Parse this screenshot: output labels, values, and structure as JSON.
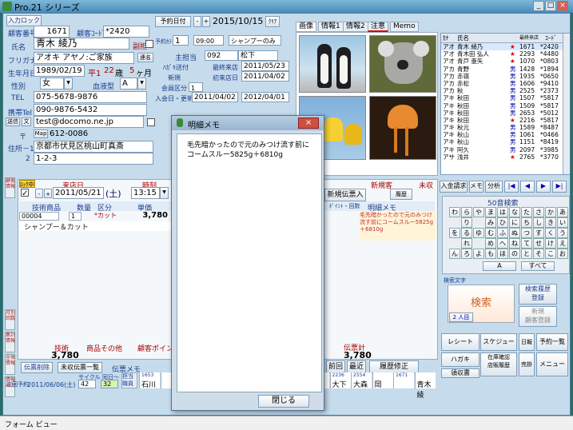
{
  "window": {
    "title": "Pro.21 シリーズ",
    "status": "フォーム ビュー"
  },
  "header": {
    "entry_lock_btn": "入力ロック",
    "customer_no_label": "顧客番号",
    "customer_no": "1671",
    "customer_code_label": "顧客ｺｰﾄﾞ",
    "customer_code": "*2420",
    "name_label": "氏名",
    "name": "青木 綾乃",
    "furigana_label": "フリガナ",
    "furigana": "アオキ アヤノ:ご家族",
    "birthday_label": "生年月日",
    "birthday": "1989/02/19",
    "era": "平1",
    "age": "22",
    "age_unit": "歳",
    "months": "5",
    "months_unit": "ヶ月",
    "sex_label": "性別",
    "sex": "女",
    "blood_label": "血液型",
    "blood": "A",
    "tel_label": "TEL",
    "tel": "075-5678-9876",
    "mobile_label": "携帯Tel",
    "mobile": "090-9876-5432",
    "email_btn": "送信",
    "email_btn2": "文",
    "email": "test@docomo.ne.jp",
    "zip_label": "〒",
    "zip": "612-0086",
    "map_btn": "Map",
    "addr1_label": "住所－1",
    "addr1": "京都市伏見区桃山町真斎",
    "addr2_label": "2",
    "addr2": "1-2-3",
    "sub_check_label": "副担",
    "family_btn": "連名",
    "reservation_btn": "予約日付",
    "reservation_date": "2015/10/15",
    "clear_btn": "ｸﾘｱ",
    "appt_time_label": "予約ｶﾃ",
    "appt_time": "09:00",
    "appt_menu": "シャンプーのみ",
    "main_staff_label": "主担当",
    "main_staff_code": "092",
    "main_staff": "松下",
    "hagaki_label": "ﾊｶﾞｷ送付",
    "last_visit_label": "最終来店",
    "last_visit": "2011/05/23",
    "new_label": "新規",
    "first_visit_label": "初来店日",
    "first_visit": "2011/04/02",
    "member_label": "会員区分",
    "member": "1",
    "join_label": "入会日・更新",
    "join_date": "2011/04/02",
    "renew_date": "2012/04/01",
    "col1_label": "ヨ",
    "col2_label": "ヘ",
    "col3_label": "ロ",
    "col4_label": "ヨ",
    "col5_label": "ロ"
  },
  "tabs": [
    "画像",
    "情報1",
    "情報2",
    "注意",
    "Memo"
  ],
  "photos": [
    "penguins-photo",
    "koala-photo",
    "tulips-photo",
    "jellyfish-photo"
  ],
  "list": {
    "headers": [
      "ｶﾅ",
      "氏名",
      "最終来店",
      "ｺｰﾄﾞ"
    ],
    "rows": [
      {
        "kana": "アオ",
        "name": "青木 綾乃",
        "mark": "★",
        "no": "1671",
        "code": "*2420"
      },
      {
        "kana": "アオ",
        "name": "青木田 弘人",
        "mark": "★",
        "no": "2293",
        "code": "*4480"
      },
      {
        "kana": "アオ",
        "name": "青戸 亜矢",
        "mark": "★",
        "no": "1070",
        "code": "*0803"
      },
      {
        "kana": "アカ",
        "name": "青野",
        "mark": "男",
        "no": "1428",
        "code": "*1894"
      },
      {
        "kana": "アカ",
        "name": "赤嶺",
        "mark": "男",
        "no": "1935",
        "code": "*0650"
      },
      {
        "kana": "アカ",
        "name": "赤松",
        "mark": "男",
        "no": "1606",
        "code": "*9410"
      },
      {
        "kana": "アカ",
        "name": "秋",
        "mark": "男",
        "no": "2525",
        "code": "*2373"
      },
      {
        "kana": "アキ",
        "name": "秋田",
        "mark": "男",
        "no": "1507",
        "code": "*5817"
      },
      {
        "kana": "アキ",
        "name": "秋田",
        "mark": "男",
        "no": "1509",
        "code": "*5817"
      },
      {
        "kana": "アキ",
        "name": "秋田",
        "mark": "男",
        "no": "2653",
        "code": "*5012"
      },
      {
        "kana": "アキ",
        "name": "秋田",
        "mark": "★",
        "no": "2216",
        "code": "*5817"
      },
      {
        "kana": "アキ",
        "name": "秋元",
        "mark": "男",
        "no": "1589",
        "code": "*8487"
      },
      {
        "kana": "アキ",
        "name": "秋山",
        "mark": "男",
        "no": "1061",
        "code": "*0466"
      },
      {
        "kana": "アキ",
        "name": "秋山",
        "mark": "男",
        "no": "1151",
        "code": "*8419"
      },
      {
        "kana": "アキ",
        "name": "阿久",
        "mark": "男",
        "no": "2097",
        "code": "*3985"
      },
      {
        "kana": "アサ",
        "name": "浅井",
        "mark": "★",
        "no": "2765",
        "code": "*3770"
      }
    ]
  },
  "nav": {
    "buttons": [
      "入金請求",
      "メモ",
      "分析"
    ],
    "first": "|◀",
    "prev": "◀",
    "next": "▶",
    "last": "▶|"
  },
  "kana_search": {
    "title": "50音検索",
    "grid": [
      "わ",
      "ら",
      "や",
      "ま",
      "は",
      "な",
      "た",
      "さ",
      "か",
      "あ",
      "",
      "り",
      "",
      "み",
      "ひ",
      "に",
      "ち",
      "し",
      "き",
      "い",
      "を",
      "る",
      "ゆ",
      "む",
      "ふ",
      "ぬ",
      "つ",
      "す",
      "く",
      "う",
      "",
      "れ",
      "",
      "め",
      "へ",
      "ね",
      "て",
      "せ",
      "け",
      "え",
      "ん",
      "ろ",
      "よ",
      "も",
      "ほ",
      "の",
      "と",
      "そ",
      "こ",
      "お"
    ],
    "a_btn": "A",
    "all_btn": "すべて",
    "search_char_label": "検索文字",
    "search_btn": "検索",
    "history_btn": "検索履歴\n登録",
    "new_reg_btn": "新規\n顧客登録",
    "count": "2 人目"
  },
  "right_menu": {
    "receipt": "レシート",
    "schedule": "スケジュール",
    "calendar": "日報",
    "appt_list": "予約一覧",
    "hagaki": "ハガキ",
    "visit_check": "在庫確認\n店販履歴",
    "receivable": "売掛",
    "menu": "メニュー",
    "receipt2": "領収書",
    "survey": "集計"
  },
  "slip": {
    "lock_label": "ﾛｯｸ中",
    "visit_label": "来店日",
    "visit_date": "2011/05/21",
    "weekday": "(土)",
    "time_label": "時刻",
    "time": "13:15",
    "new_slip_btn": "新規伝票入力",
    "new_reg_label": "新規客",
    "history_btn": "履歴",
    "unpaid_label": "未収",
    "col_headers": [
      "技術商品",
      "数量",
      "区分",
      "単価",
      "明細メモ"
    ],
    "row1_code": "00004",
    "row1_qty": "1",
    "row1_kubun": "*カット",
    "row1_price": "3,780",
    "row1_name": "シャンプー＆カット",
    "row1_memo": "毛先暗かったので元のみつけ流す前にコームスルー5825g＋6810g",
    "point_label": "ﾎﾟｲﾝﾄ・回数",
    "tech_label": "技術",
    "product_label": "商品その他",
    "customer_point_label": "顧客ポイント",
    "tech_total": "3,780",
    "slip_total_label": "伝票計",
    "slip_total": "3,780",
    "delete_btn": "伝票削除",
    "unpaid_list_btn": "未収伝票一覧",
    "slip_memo_label": "伝票メモ",
    "prev_btn": "前回",
    "recent_btn": "最近",
    "history_fix_btn": "履歴修正",
    "next_appt_label": "次回予約",
    "next_appt": "2011/06/06(土)",
    "cycle_label": "サイクル",
    "cycle": "42",
    "same_label": "同日～",
    "same": "32",
    "staff_label": "担当\n職員",
    "staff_bottom": [
      "石川",
      "",
      "",
      "",
      "",
      "岩本",
      "魚江",
      "岡江",
      "大川",
      "大下",
      "大森",
      "岡",
      "",
      "青木 綾"
    ],
    "staff_nums": [
      "1653",
      "",
      "",
      "",
      "",
      "2173",
      "2685",
      "1983",
      "1722",
      "2236",
      "2554",
      "",
      "1671"
    ]
  },
  "side_labels": [
    "顧客\n情報",
    "月別\n回数",
    "集計\n情報",
    "全体\n情報",
    "情報\n出力"
  ],
  "dialog": {
    "title": "明細メモ",
    "text": "毛先暗かったので元のみつけ流す前にコームスルー5825g＋6810g",
    "close_btn": "閉じる"
  }
}
